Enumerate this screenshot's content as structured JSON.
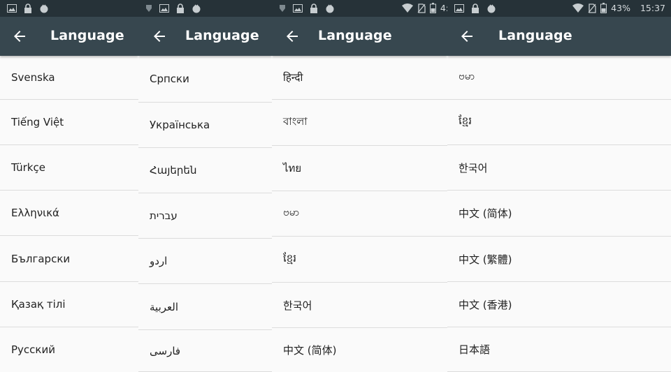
{
  "colors": {
    "status_bar": "#263238",
    "app_bar": "#37474f",
    "list_bg": "#fafafa",
    "divider": "#dcdcdc"
  },
  "panels": [
    {
      "status": {
        "right_text": ""
      },
      "title": "Language",
      "items": [
        "Svenska",
        "Tiếng Việt",
        "Türkçe",
        "Ελληνικά",
        "Български",
        "Қазақ тілі",
        "Русский"
      ]
    },
    {
      "status": {
        "right_text": ""
      },
      "title": "Language",
      "items": [
        "Српски",
        "Українська",
        "Հայերեն",
        "עברית",
        "اردو",
        "العربية",
        "فارسی"
      ]
    },
    {
      "status": {
        "right_text": "4:"
      },
      "title": "Language",
      "items": [
        "हिन्दी",
        "বাংলা",
        "ไทย",
        "ဗမာ",
        "ខ្មែរ",
        "한국어",
        "中文 (简体)"
      ]
    },
    {
      "status": {
        "battery": "43%",
        "time": "15:37"
      },
      "title": "Language",
      "items": [
        "ဗမာ",
        "ខ្មែរ",
        "한국어",
        "中文 (简体)",
        "中文 (繁體)",
        "中文 (香港)",
        "日本語"
      ]
    }
  ]
}
